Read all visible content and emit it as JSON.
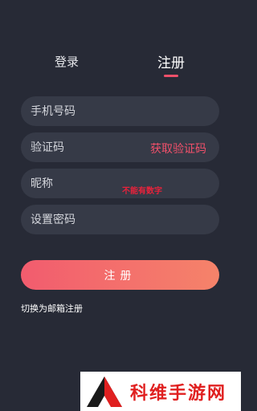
{
  "tabs": {
    "login_label": "登录",
    "register_label": "注册"
  },
  "form": {
    "phone_placeholder": "手机号码",
    "code_placeholder": "验证码",
    "get_code_label": "获取验证码",
    "nickname_placeholder": "昵称",
    "nickname_hint": "不能有数字",
    "password_placeholder": "设置密码",
    "submit_label": "注册"
  },
  "switch_link_label": "切换为邮箱注册",
  "watermark": {
    "text": "科维手游网"
  },
  "colors": {
    "background": "#272a36",
    "field": "#363a47",
    "accent": "#f0506a",
    "gradient_start": "#f25c6e",
    "gradient_end": "#f5836a"
  }
}
